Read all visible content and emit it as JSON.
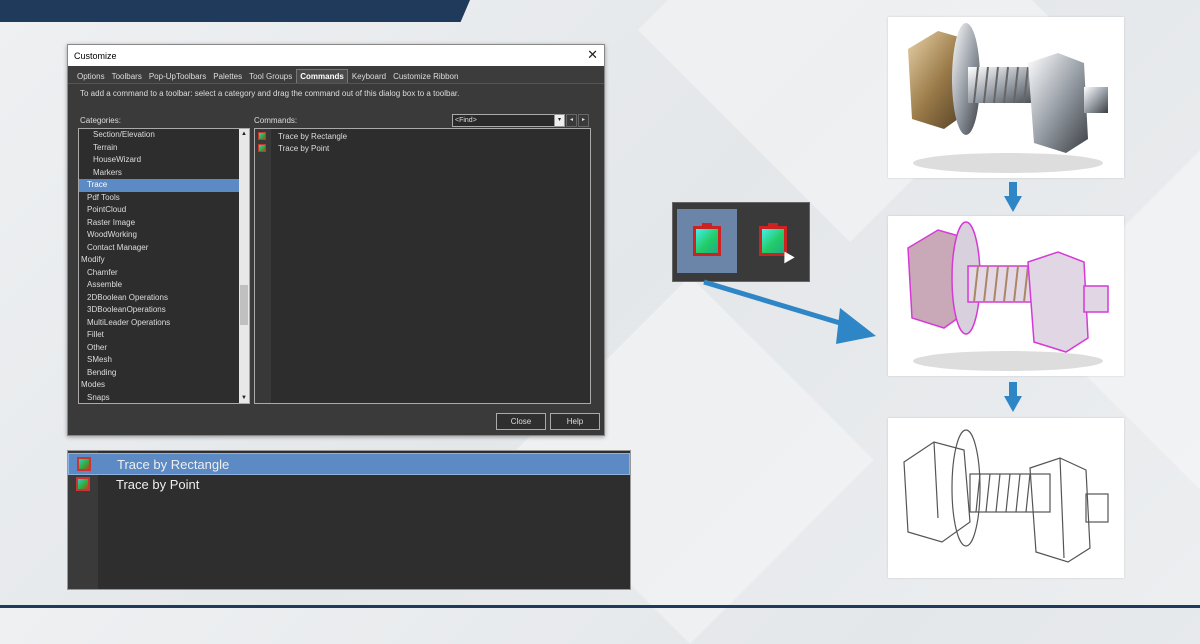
{
  "dialog": {
    "title": "Customize",
    "tabs": [
      "Options",
      "Toolbars",
      "Pop-UpToolbars",
      "Palettes",
      "Tool Groups",
      "Commands",
      "Keyboard",
      "Customize Ribbon"
    ],
    "active_tab": "Commands",
    "instruction": "To add a command to a toolbar: select a category and drag the command out of this dialog box to a toolbar.",
    "categories_label": "Categories:",
    "commands_label": "Commands:",
    "find_value": "<Find>",
    "categories": [
      {
        "label": "Section/Elevation",
        "indent": 2
      },
      {
        "label": "Terrain",
        "indent": 2
      },
      {
        "label": "HouseWizard",
        "indent": 2
      },
      {
        "label": "Markers",
        "indent": 2
      },
      {
        "label": "Trace",
        "indent": 1,
        "selected": true
      },
      {
        "label": "Pdf Tools",
        "indent": 1
      },
      {
        "label": "PointCloud",
        "indent": 1
      },
      {
        "label": "Raster Image",
        "indent": 1
      },
      {
        "label": "WoodWorking",
        "indent": 1
      },
      {
        "label": "Contact Manager",
        "indent": 1
      },
      {
        "label": "Modify",
        "indent": 0
      },
      {
        "label": "Chamfer",
        "indent": 1
      },
      {
        "label": "Assemble",
        "indent": 1
      },
      {
        "label": "2DBoolean Operations",
        "indent": 1
      },
      {
        "label": "3DBooleanOperations",
        "indent": 1
      },
      {
        "label": "MultiLeader Operations",
        "indent": 1
      },
      {
        "label": "Fillet",
        "indent": 1
      },
      {
        "label": "Other",
        "indent": 1
      },
      {
        "label": "SMesh",
        "indent": 1
      },
      {
        "label": "Bending",
        "indent": 1
      },
      {
        "label": "Modes",
        "indent": 0
      },
      {
        "label": "Snaps",
        "indent": 1
      }
    ],
    "commands": [
      "Trace by Rectangle",
      "Trace by Point"
    ],
    "close_label": "Close",
    "help_label": "Help"
  },
  "zoom_panel": {
    "items": [
      "Trace by Rectangle",
      "Trace by Point"
    ]
  },
  "colors": {
    "accent_blue": "#2f86c6",
    "selection": "#5b8ac4",
    "header_navy": "#1f3a5a"
  }
}
